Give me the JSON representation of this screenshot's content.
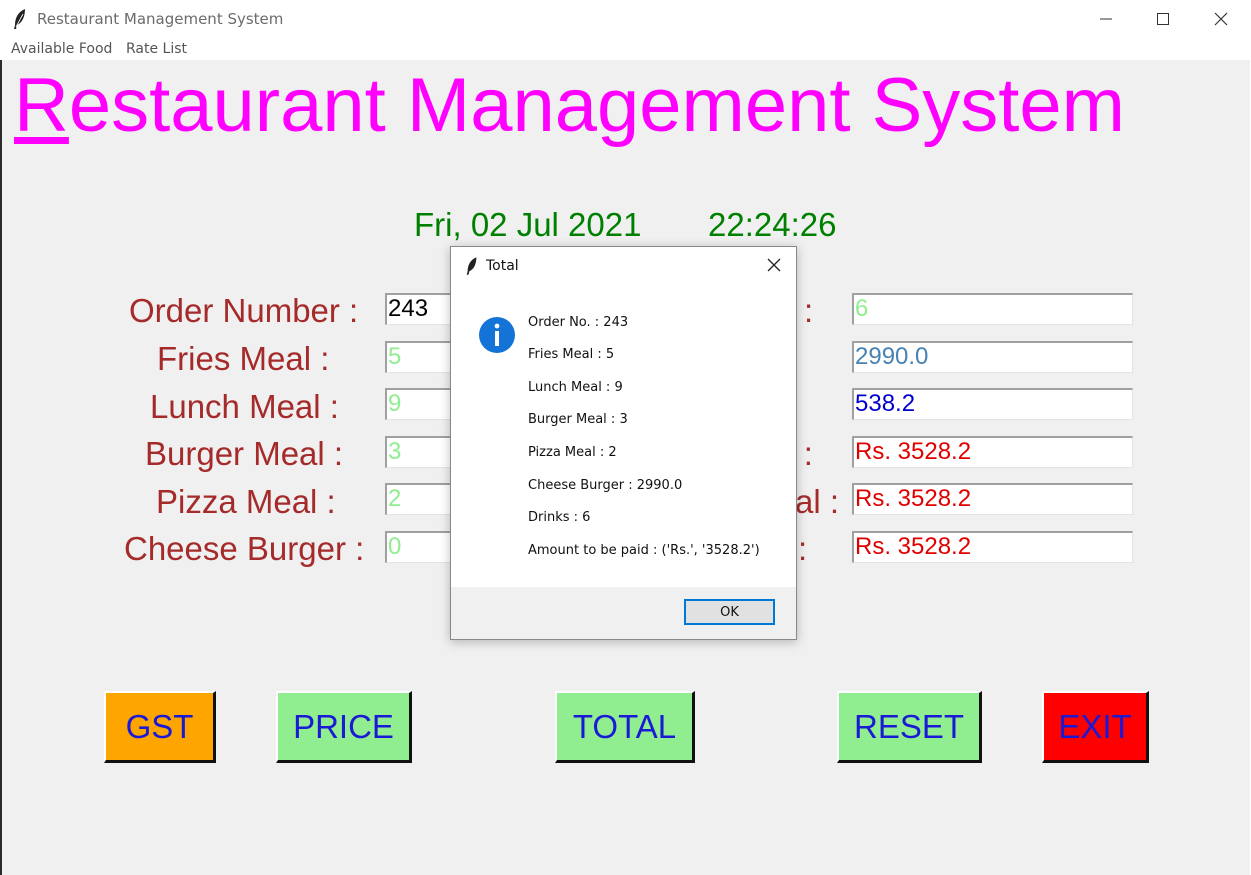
{
  "window": {
    "title": "Restaurant Management System",
    "controls": [
      "minimize-icon",
      "maximize-icon",
      "close-icon"
    ]
  },
  "menu": {
    "items": [
      "Available Food",
      "Rate List"
    ]
  },
  "header": {
    "title_first": "R",
    "title_rest": "estaurant Management System",
    "date": "Fri, 02 Jul 2021",
    "time": "22:24:26"
  },
  "form": {
    "left": [
      {
        "label": "Order Number :",
        "value": "243"
      },
      {
        "label": "Fries Meal :",
        "value": "5"
      },
      {
        "label": "Lunch Meal :",
        "value": "9"
      },
      {
        "label": "Burger Meal :",
        "value": "3"
      },
      {
        "label": "Pizza Meal :",
        "value": "2"
      },
      {
        "label": "Cheese Burger :",
        "value": "0"
      }
    ],
    "right": [
      {
        "label_visible": ":",
        "value": "6"
      },
      {
        "label_visible": "",
        "value": "2990.0"
      },
      {
        "label_visible": "",
        "value": "538.2"
      },
      {
        "label_visible": "T :",
        "value": "Rs. 3528.2"
      },
      {
        "label_visible": "al :",
        "value": "Rs. 3528.2"
      },
      {
        "label_visible": ":",
        "value": "Rs. 3528.2"
      }
    ]
  },
  "buttons": {
    "gst": "GST",
    "price": "PRICE",
    "total": "TOTAL",
    "reset": "RESET",
    "exit": "EXIT"
  },
  "colors": {
    "title": "#ff00ff",
    "labels": "#a52a2a",
    "datetime": "#008000",
    "gst_button": "#ffa500",
    "green_button": "#90ee90",
    "exit_button": "#ff0000",
    "button_text": "#1a1ad6"
  },
  "dialog": {
    "title": "Total",
    "icon": "info-icon",
    "lines": [
      "Order No. :  243",
      "Fries Meal :  5",
      "Lunch Meal :  9",
      "Burger Meal :  3",
      "Pizza Meal :  2",
      "Cheese Burger :  2990.0",
      "Drinks :  6",
      "Amount to be paid :  ('Rs.', '3528.2')"
    ],
    "ok_label": "OK"
  }
}
